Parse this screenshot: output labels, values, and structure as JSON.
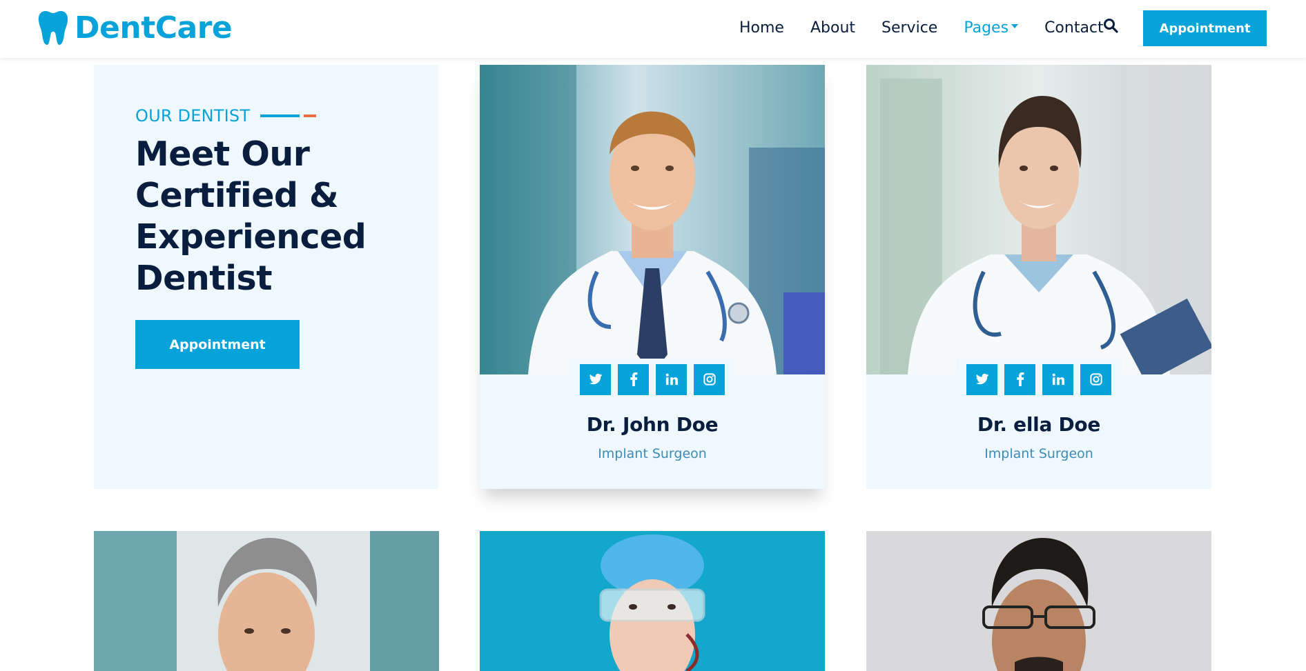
{
  "brand": {
    "name": "DentCare"
  },
  "nav": {
    "links": [
      {
        "label": "Home"
      },
      {
        "label": "About"
      },
      {
        "label": "Service"
      },
      {
        "label": "Pages"
      },
      {
        "label": "Contact"
      }
    ],
    "appointment_label": "Appointment"
  },
  "intro": {
    "eyebrow": "OUR DENTIST",
    "title": "Meet Our Certified & Experienced Dentist",
    "button_label": "Appointment"
  },
  "team": [
    {
      "name": "Dr. John Doe",
      "role": "Implant Surgeon"
    },
    {
      "name": "Dr. ella Doe",
      "role": "Implant Surgeon"
    }
  ],
  "colors": {
    "primary": "#06a3da",
    "dark": "#091e3e",
    "light_bg": "#eef8fe",
    "accent": "#ea6c43"
  },
  "icons": [
    "tooth-icon",
    "search-icon",
    "twitter-icon",
    "facebook-icon",
    "linkedin-icon",
    "instagram-icon"
  ]
}
